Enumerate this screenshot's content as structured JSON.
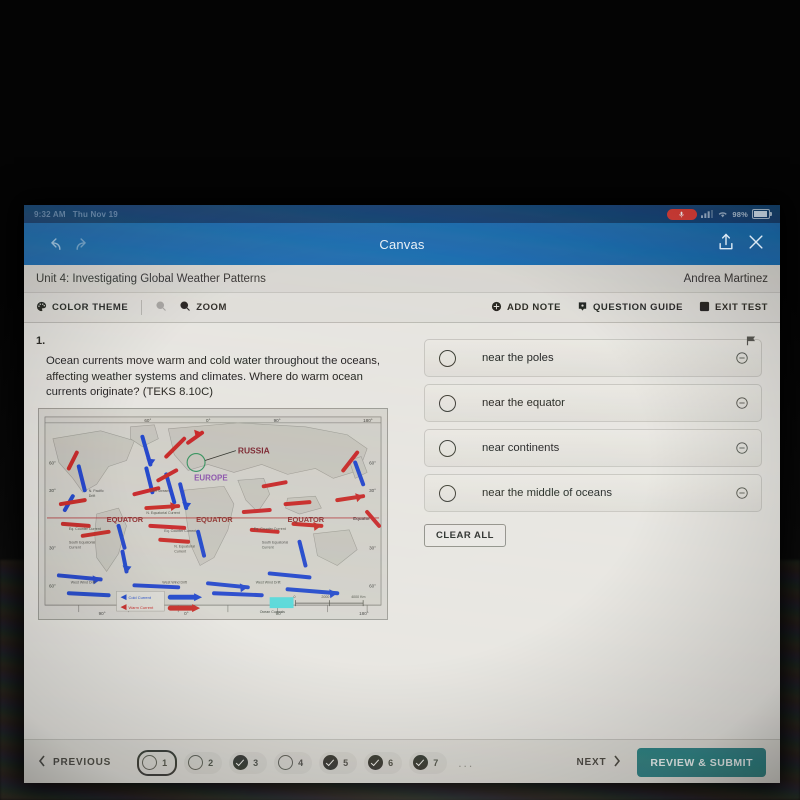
{
  "status_bar": {
    "time": "9:32 AM",
    "date": "Thu Nov 19",
    "battery_percent": "98%",
    "recording_icon": "microphone-recording-icon",
    "signal_icon": "cellular-signal-icon",
    "wifi_icon": "wifi-icon",
    "battery_icon": "battery-icon"
  },
  "app_bar": {
    "title": "Canvas",
    "back_icon": "back-arrow-icon",
    "forward_icon": "forward-arrow-icon",
    "share_icon": "share-icon",
    "close_icon": "close-icon"
  },
  "unit_bar": {
    "unit_title": "Unit 4: Investigating Global Weather Patterns",
    "student_name": "Andrea Martinez"
  },
  "toolbar": {
    "color_theme_label": "COLOR THEME",
    "color_theme_icon": "palette-icon",
    "zoom_out_icon": "zoom-out-icon",
    "zoom_label": "ZOOM",
    "zoom_in_icon": "zoom-in-icon",
    "add_note_label": "ADD NOTE",
    "add_note_icon": "add-note-icon",
    "question_guide_label": "QUESTION GUIDE",
    "question_guide_icon": "question-guide-icon",
    "exit_test_label": "EXIT TEST",
    "exit_test_icon": "exit-icon"
  },
  "question": {
    "number": "1.",
    "text": "Ocean currents move warm and cold water throughout the oceans, affecting weather systems and climates. Where do warm ocean currents originate?  (TEKS 8.10C)",
    "flag_icon": "flag-icon"
  },
  "stimulus_map": {
    "alt": "World map of ocean currents",
    "labels": [
      "RUSSIA",
      "EUROPE",
      "EQUATOR",
      "EQUATOR",
      "EQUATOR"
    ],
    "current_labels": [
      "N. Equatorial Current",
      "Eq. Counter Current",
      "South Equatorial Current",
      "West Wind Drift",
      "Gulf Stream"
    ],
    "legend": [
      {
        "label": "Cold Current",
        "color": "#1b3fc9"
      },
      {
        "label": "Warm Current",
        "color": "#c62222"
      }
    ],
    "scale_ticks": [
      "0",
      "2000",
      "4000 Km"
    ],
    "latitude_labels": [
      "60°",
      "30°",
      "0°",
      "30°",
      "60°"
    ],
    "longitude_labels": [
      "180°",
      "90°",
      "0°",
      "90°",
      "180°"
    ],
    "scale_caption": "Ocean Currents"
  },
  "options": [
    {
      "label": "near the poles",
      "selected": false,
      "eliminated": false,
      "eliminate_icon": "eliminate-icon"
    },
    {
      "label": "near the equator",
      "selected": false,
      "eliminated": false,
      "eliminate_icon": "eliminate-icon"
    },
    {
      "label": "near continents",
      "selected": false,
      "eliminated": false,
      "eliminate_icon": "eliminate-icon"
    },
    {
      "label": "near the middle of oceans",
      "selected": false,
      "eliminated": false,
      "eliminate_icon": "eliminate-icon"
    }
  ],
  "clear_all_label": "CLEAR ALL",
  "bottom_nav": {
    "previous_label": "PREVIOUS",
    "previous_icon": "chevron-left-icon",
    "next_label": "NEXT",
    "next_icon": "chevron-right-icon",
    "submit_label": "REVIEW & SUBMIT",
    "ellipsis": "...",
    "questions": [
      {
        "number": "1",
        "state": "current"
      },
      {
        "number": "2",
        "state": "unanswered"
      },
      {
        "number": "3",
        "state": "answered"
      },
      {
        "number": "4",
        "state": "unanswered"
      },
      {
        "number": "5",
        "state": "answered"
      },
      {
        "number": "6",
        "state": "answered"
      },
      {
        "number": "7",
        "state": "answered"
      }
    ]
  },
  "colors": {
    "status_bar_blue": "#0b3a6d",
    "app_bar_blue": "#1366ab",
    "page_bg": "#e6e4df",
    "submit_teal": "#1f7a7d",
    "record_red": "#d9352c"
  }
}
